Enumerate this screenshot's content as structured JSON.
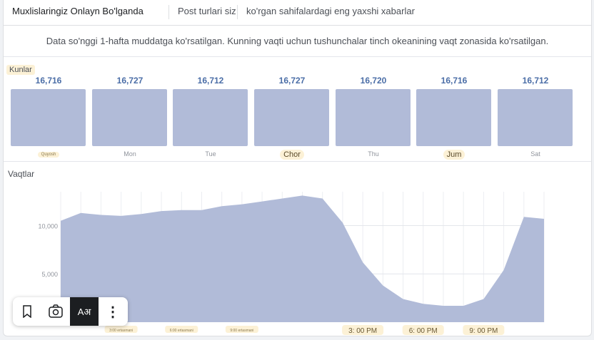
{
  "tabs": [
    {
      "label": "Muxlislaringiz Onlayn Bo'lganda",
      "active": true
    },
    {
      "label": "Post turlari siz",
      "active": false
    },
    {
      "label": "ko'rgan sahifalardagi eng yaxshi xabarlar",
      "active": false
    }
  ],
  "notice": "Data so'nggi 1-hafta muddatga ko'rsatilgan. Kunning vaqti uchun tushunchalar tinch okeanining vaqt zonasida ko'rsatilgan.",
  "days_section": {
    "label": "Kunlar",
    "days": [
      {
        "value": "16,716",
        "label": "Quyosh",
        "highlight": "small"
      },
      {
        "value": "16,727",
        "label": "Mon",
        "highlight": ""
      },
      {
        "value": "16,712",
        "label": "Tue",
        "highlight": ""
      },
      {
        "value": "16,727",
        "label": "Chor",
        "highlight": "big"
      },
      {
        "value": "16,720",
        "label": "Thu",
        "highlight": ""
      },
      {
        "value": "16,716",
        "label": "Jum",
        "highlight": "big"
      },
      {
        "value": "16,712",
        "label": "Sat",
        "highlight": ""
      }
    ]
  },
  "hours_section": {
    "label": "Vaqtlar"
  },
  "colors": {
    "bar": "#b1bbd8",
    "area": "#b1bbd8",
    "value_text": "#4b6ea7",
    "highlight": "#fcf1d6"
  },
  "chart_data": {
    "type": "area",
    "title": "",
    "ylabel": "",
    "ylim": [
      0,
      13500
    ],
    "y_ticks": [
      "5,000",
      "10,000"
    ],
    "x_ticks_small": [
      "3:00 ertasmani",
      "6:00 ertasmani",
      "9:00 ertasmani"
    ],
    "x_ticks": [
      "3: 00 PM",
      "6: 00 PM",
      "9: 00 PM"
    ],
    "grid": true,
    "hours": [
      0,
      1,
      2,
      3,
      4,
      5,
      6,
      7,
      8,
      9,
      10,
      11,
      12,
      13,
      14,
      15,
      16,
      17,
      18,
      19,
      20,
      21,
      22,
      23,
      24
    ],
    "values": [
      10500,
      11300,
      11100,
      11000,
      11200,
      11500,
      11600,
      11600,
      12000,
      12200,
      12500,
      12800,
      13100,
      12800,
      10300,
      6200,
      3800,
      2400,
      1900,
      1700,
      1700,
      2400,
      5400,
      10900,
      10700
    ]
  },
  "toolbar": {
    "bookmark_icon": "bookmark-icon",
    "lens_icon": "camera-lens-icon",
    "translate_label": "Aअ",
    "more_icon": "⋮"
  }
}
